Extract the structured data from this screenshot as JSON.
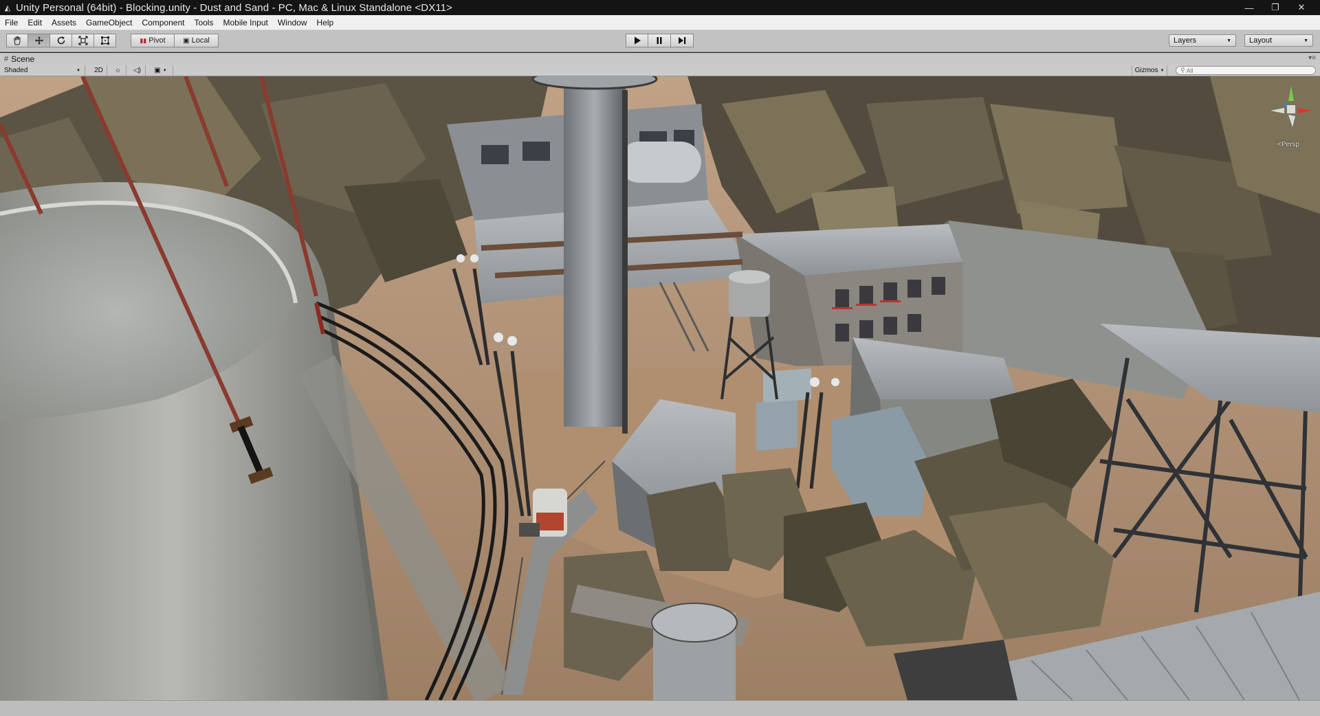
{
  "window": {
    "title": "Unity Personal (64bit) - Blocking.unity - Dust and Sand - PC, Mac & Linux Standalone <DX11>",
    "controls": {
      "minimize": "—",
      "maximize": "❐",
      "close": "✕"
    }
  },
  "menu": [
    "File",
    "Edit",
    "Assets",
    "GameObject",
    "Component",
    "Tools",
    "Mobile Input",
    "Window",
    "Help"
  ],
  "toolbar": {
    "transform_tools": [
      "hand-tool",
      "move-tool",
      "rotate-tool",
      "scale-tool",
      "rect-tool"
    ],
    "active_tool": "move-tool",
    "pivot_label": "Pivot",
    "space_label": "Local",
    "play_controls": [
      "play",
      "pause",
      "step"
    ],
    "layers_label": "Layers",
    "layout_label": "Layout"
  },
  "scene_panel": {
    "tab_label": "Scene",
    "draw_mode": "Shaded",
    "mode_2d": "2D",
    "gizmos_label": "Gizmos",
    "search_placeholder": "All",
    "projection_label": "Persp"
  },
  "colors": {
    "title_bar": "#141414",
    "toolbar": "#c2c2c2",
    "sand": "#a58a6e",
    "rock": "#4b4538",
    "concrete": "#9a9a92"
  }
}
